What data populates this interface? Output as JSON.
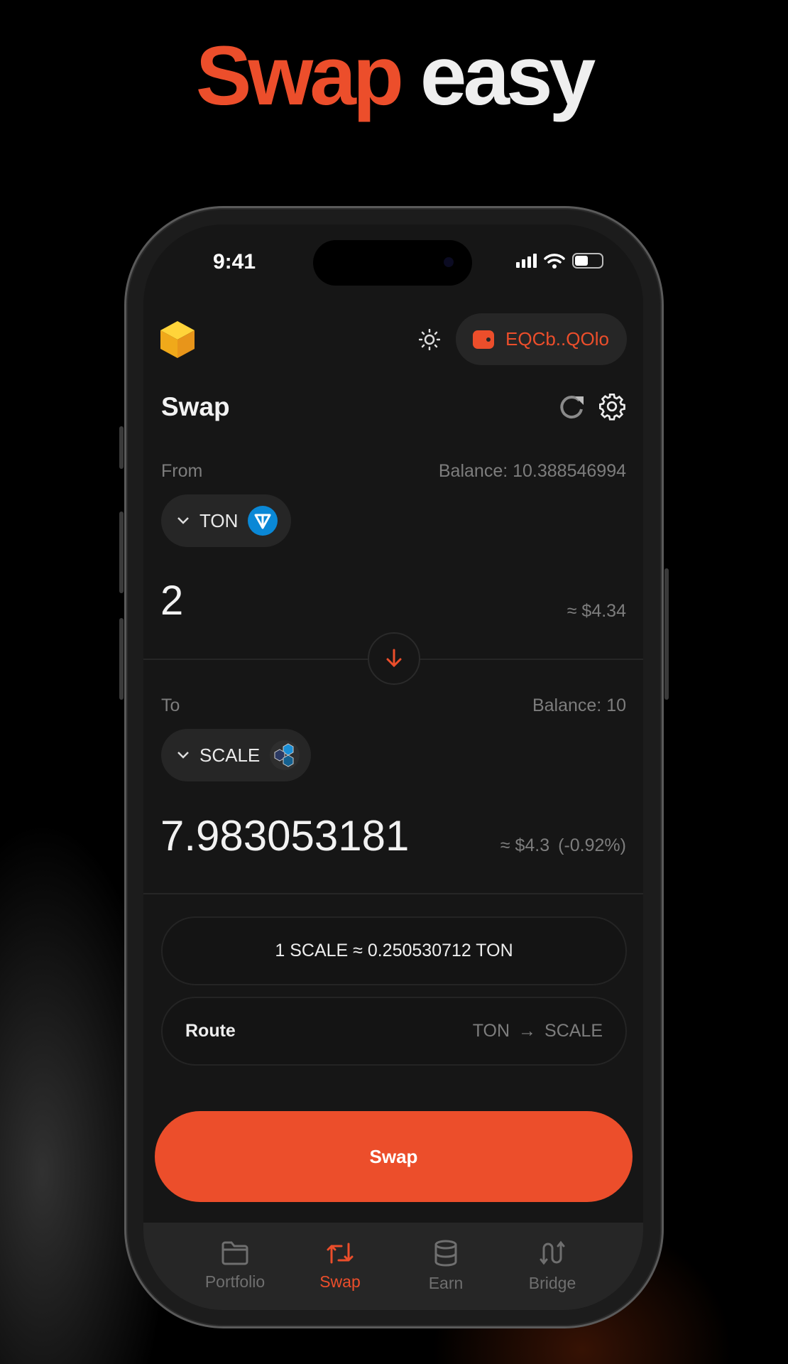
{
  "headline": {
    "accent": "Swap",
    "rest": "easy"
  },
  "status_bar": {
    "time": "9:41"
  },
  "header": {
    "wallet_address": "EQCb..QOlo",
    "theme_icon": "sun-icon",
    "wallet_icon": "wallet-icon"
  },
  "page": {
    "title": "Swap"
  },
  "from": {
    "label": "From",
    "balance": "Balance: 10.388546994",
    "token": "TON",
    "amount": "2",
    "usd": "≈ $4.34"
  },
  "to": {
    "label": "To",
    "balance": "Balance: 10",
    "token": "SCALE",
    "amount": "7.983053181",
    "usd": "≈ $4.3",
    "change": "(-0.92%)"
  },
  "rate": "1 SCALE ≈ 0.250530712 TON",
  "route": {
    "label": "Route",
    "from": "TON",
    "to": "SCALE"
  },
  "swap_button": "Swap",
  "tabs": [
    {
      "label": "Portfolio",
      "icon": "folder-icon"
    },
    {
      "label": "Swap",
      "icon": "swap-icon",
      "active": true
    },
    {
      "label": "Earn",
      "icon": "database-icon"
    },
    {
      "label": "Bridge",
      "icon": "bridge-icon"
    }
  ],
  "colors": {
    "accent": "#ec4e2b",
    "screen_bg": "#161616",
    "ton_blue": "#0a88d6"
  }
}
